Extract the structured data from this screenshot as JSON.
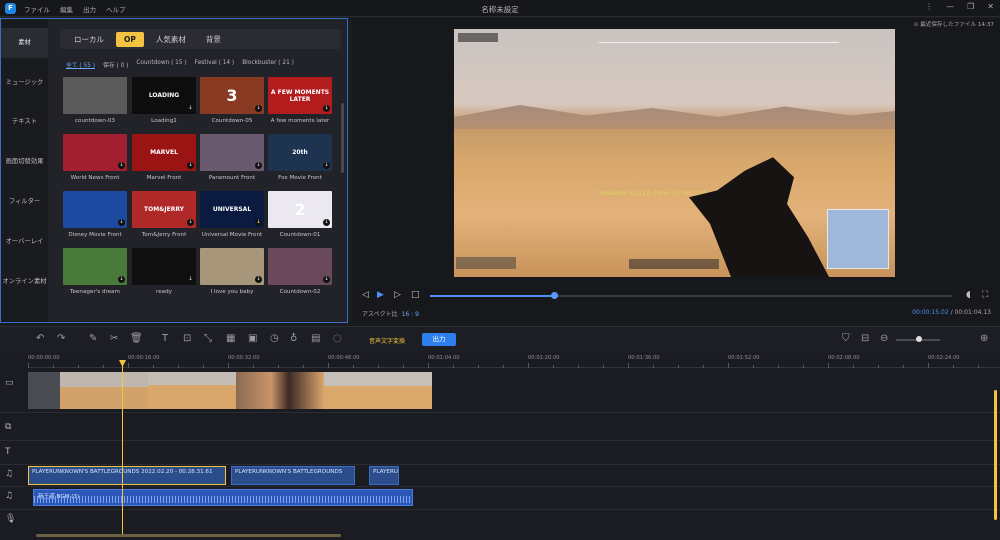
{
  "app": {
    "title": "名称未設定",
    "menu": [
      "ファイル",
      "編集",
      "出力",
      "ヘルプ"
    ],
    "window_controls": [
      "⋮",
      "—",
      "❐",
      "✕"
    ]
  },
  "sidebar": {
    "items": [
      {
        "label": "素材",
        "active": true
      },
      {
        "label": "ミュージック"
      },
      {
        "label": "テキスト"
      },
      {
        "label": "画面切替効果"
      },
      {
        "label": "フィルター"
      },
      {
        "label": "オーバーレイ"
      },
      {
        "label": "オンライン素材"
      }
    ]
  },
  "media": {
    "tabs": [
      {
        "label": "ローカル"
      },
      {
        "label": "OP",
        "active": true
      },
      {
        "label": "人気素材"
      },
      {
        "label": "背景"
      }
    ],
    "filters": [
      "全て ( 55 )",
      "保存 ( 0 )",
      "Countdown ( 15 )",
      "Festival ( 14 )",
      "Blockbuster ( 21 )"
    ],
    "thumbnails": [
      {
        "caption": "countdown-03",
        "color": "#5a5a5a",
        "text": ""
      },
      {
        "caption": "Loading1",
        "color": "#0d0d0d",
        "text": "LOADING"
      },
      {
        "caption": "Countdown-05",
        "color": "#8a3a22",
        "text": "3"
      },
      {
        "caption": "A few moments later",
        "color": "#b31c1c",
        "text": "A FEW MOMENTS LATER"
      },
      {
        "caption": "World News Front",
        "color": "#a02030",
        "text": ""
      },
      {
        "caption": "Marvel Front",
        "color": "#9a1414",
        "text": "MARVEL"
      },
      {
        "caption": "Paramount Front",
        "color": "#6a5a70",
        "text": ""
      },
      {
        "caption": "Fox Movie Front",
        "color": "#1d3350",
        "text": "20th"
      },
      {
        "caption": "Disney Movie Front",
        "color": "#1c4aa0",
        "text": ""
      },
      {
        "caption": "Tom&Jerry Front",
        "color": "#b02828",
        "text": "TOM&JERRY"
      },
      {
        "caption": "Universal Movie Front",
        "color": "#0a1a40",
        "text": "UNIVERSAL"
      },
      {
        "caption": "Countdown-01",
        "color": "#ece8f2",
        "text": "2"
      },
      {
        "caption": "Teenager's dream",
        "color": "#4a7a3a",
        "text": ""
      },
      {
        "caption": "ready",
        "color": "#101010",
        "text": ""
      },
      {
        "caption": "I love you baby",
        "color": "#a8967a",
        "text": ""
      },
      {
        "caption": "Countdown-02",
        "color": "#6a4a5a",
        "text": ""
      }
    ]
  },
  "preview": {
    "autosave": "⊙ 最近保存したファイル 14:37",
    "overlay_text": "IMBRAVE KILLED PIEW 10 SECONDS",
    "aspect_label": "アスペクト比",
    "aspect_value": "16 : 9",
    "current_time": "00:00:15.02",
    "total_time": "00:01:04.13",
    "progress": 0.238
  },
  "toolbar": {
    "speech_to_text": "音声文字変換",
    "export": "出力"
  },
  "timeline": {
    "ruler": [
      "00:00:00.00",
      "00:00:16.00",
      "00:00:32.00",
      "00:00:48.00",
      "00:01:04.00",
      "00:01:20.00",
      "00:01:36.00",
      "00:01:52.00",
      "00:02:08.00",
      "00:02:24.00"
    ],
    "audio_clips": [
      {
        "label": "PLAYERUNKNOWN'S BATTLEGROUNDS 2022.02.20 - 00.28.31.61"
      },
      {
        "label": "PLAYERUNKNOWN'S BATTLEGROUNDS"
      },
      {
        "label": "PLAYERU"
      }
    ],
    "music_clip": "新王道 BGM (3)"
  }
}
